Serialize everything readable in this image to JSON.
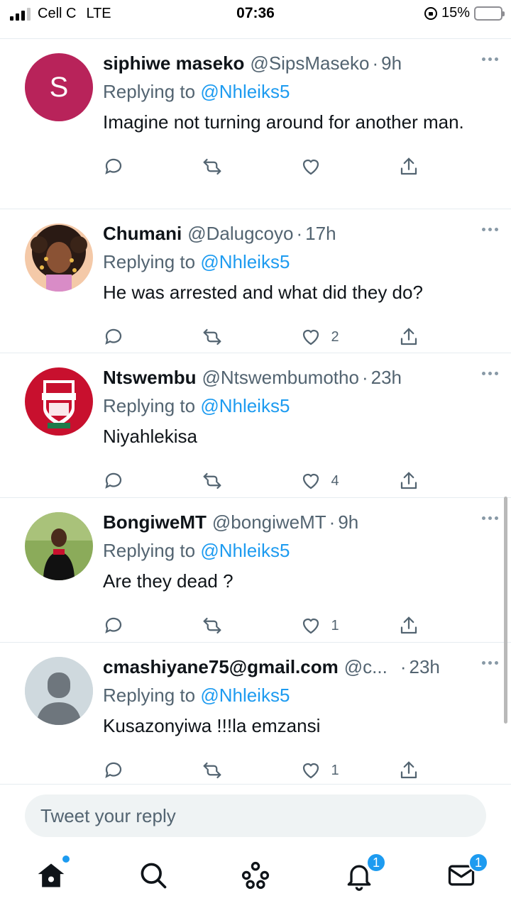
{
  "status_bar": {
    "carrier": "Cell C",
    "network": "LTE",
    "time": "07:36",
    "battery_percent": "15%",
    "battery_level": 0.15
  },
  "tweets": [
    {
      "avatar_letter": "S",
      "name": "siphiwe maseko",
      "handle": "@SipsMaseko",
      "dot": "·",
      "time": "9h",
      "replying_label": "Replying to",
      "replying_to": "@Nhleiks5",
      "text": "Imagine not turning around for another man.",
      "likes": ""
    },
    {
      "avatar_letter": "",
      "name": "Chumani",
      "handle": "@Dalugcoyo",
      "dot": "·",
      "time": "17h",
      "replying_label": "Replying to",
      "replying_to": "@Nhleiks5",
      "text": "He was arrested and what did they do?",
      "likes": "2"
    },
    {
      "avatar_letter": "",
      "name": "Ntswembu",
      "handle": "@Ntswembumotho",
      "dot": "·",
      "time": "23h",
      "replying_label": "Replying to",
      "replying_to": "@Nhleiks5",
      "text": "Niyahlekisa",
      "likes": "4"
    },
    {
      "avatar_letter": "",
      "name": "BongiweMT",
      "handle": "@bongiweMT",
      "dot": "·",
      "time": "9h",
      "replying_label": "Replying to",
      "replying_to": "@Nhleiks5",
      "text": "Are they dead ?",
      "likes": "1"
    },
    {
      "avatar_letter": "",
      "name": "cmashiyane75@gmail.com",
      "handle": "@c...",
      "dot": "·",
      "time": "23h",
      "replying_label": "Replying to",
      "replying_to": "@Nhleiks5",
      "text": "Kusazonyiwa !!!la emzansi",
      "likes": "1"
    }
  ],
  "reply_bar": {
    "placeholder": "Tweet your reply"
  },
  "tabbar": {
    "notifications_badge": "1",
    "messages_badge": "1"
  },
  "colors": {
    "accent": "#1d9bf0",
    "avatar_s": "#b8235a"
  }
}
